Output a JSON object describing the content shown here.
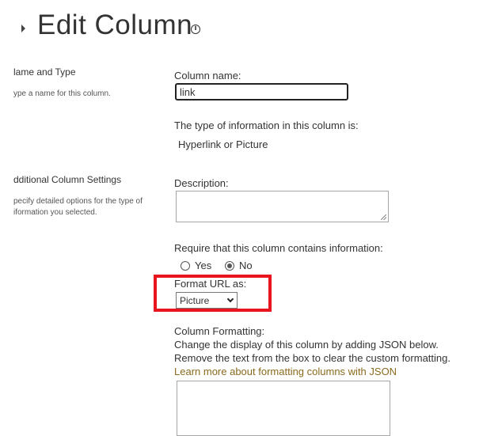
{
  "header": {
    "title": "Edit Column"
  },
  "sections": {
    "name_type": {
      "title": "lame and Type",
      "description": "ype a name for this column."
    },
    "additional": {
      "title": "dditional Column Settings",
      "description_line1": "pecify detailed options for the type of",
      "description_line2": "iformation you selected."
    }
  },
  "fields": {
    "column_name_label": "Column name:",
    "column_name_value": "link",
    "type_label": "The type of information in this column is:",
    "type_value": "Hyperlink or Picture",
    "description_label": "Description:",
    "require_label": "Require that this column contains information:",
    "require_yes": "Yes",
    "require_no": "No",
    "require_selected": "No",
    "format_url_label": "Format URL as:",
    "format_url_value": "Picture",
    "column_formatting_label": "Column Formatting:",
    "column_formatting_help1": "Change the display of this column by adding JSON below.",
    "column_formatting_help2": "Remove the text from the box to clear the custom formatting.",
    "learn_more_link": "Learn more about formatting columns with JSON"
  },
  "colors": {
    "highlight": "#e8141e",
    "link": "#8a6a1e"
  }
}
